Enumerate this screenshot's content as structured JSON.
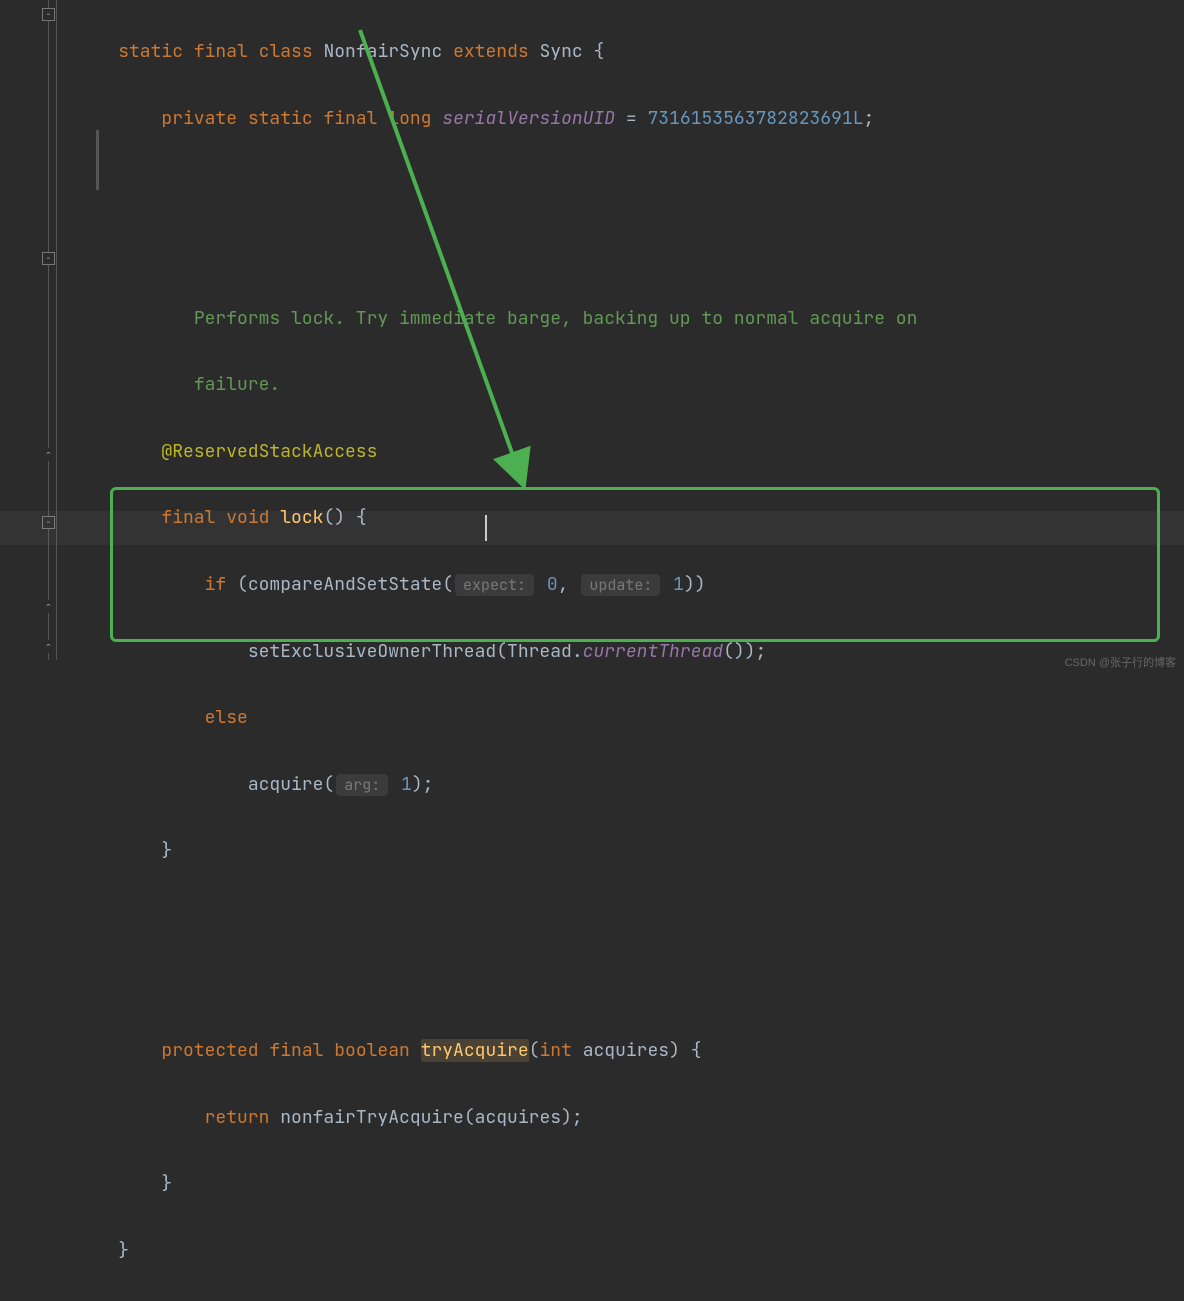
{
  "code": {
    "line1": {
      "kw1": "static",
      "kw2": "final",
      "kw3": "class",
      "name": "NonfairSync",
      "kw4": "extends",
      "parent": "Sync",
      "brace": "{"
    },
    "line2": {
      "kw1": "private",
      "kw2": "static",
      "kw3": "final",
      "type": "long",
      "field": "serialVersionUID",
      "eq": " = ",
      "val": "7316153563782823691L",
      "semi": ";"
    },
    "doc1": "Performs lock. Try immediate barge, backing up to normal acquire on ",
    "doc2": "failure.",
    "anno": "@ReservedStackAccess",
    "line3": {
      "kw1": "final",
      "kw2": "void",
      "name": "lock",
      "paren": "() {"
    },
    "line4": {
      "kw": "if",
      "open": " (",
      "call": "compareAndSetState",
      "paren": "(",
      "hint1": "expect:",
      "val1": "0",
      "comma": ",",
      "hint2": "update:",
      "val2": "1",
      "close": "))"
    },
    "line5": {
      "call": "setExclusiveOwnerThread",
      "open": "(",
      "thread": "Thread",
      "dot": ".",
      "italic": "currentThread",
      "close": "());"
    },
    "line6": {
      "kw": "else"
    },
    "line7": {
      "call": "acquire",
      "open": "(",
      "hint": "arg:",
      "val": "1",
      "close": ");"
    },
    "line8": "}",
    "line9": {
      "kw1": "protected",
      "kw2": "final",
      "kw3": "boolean",
      "name": "tryAcquire",
      "open": "(",
      "type": "int",
      "param": "acquires",
      "close": ") {"
    },
    "line10": {
      "kw": "return",
      "call": "nonfairTryAcquire",
      "open": "(",
      "param": "acquires",
      "close": ");"
    },
    "line11": "}",
    "line12": "}"
  },
  "watermark": "CSDN @张子行的博客"
}
